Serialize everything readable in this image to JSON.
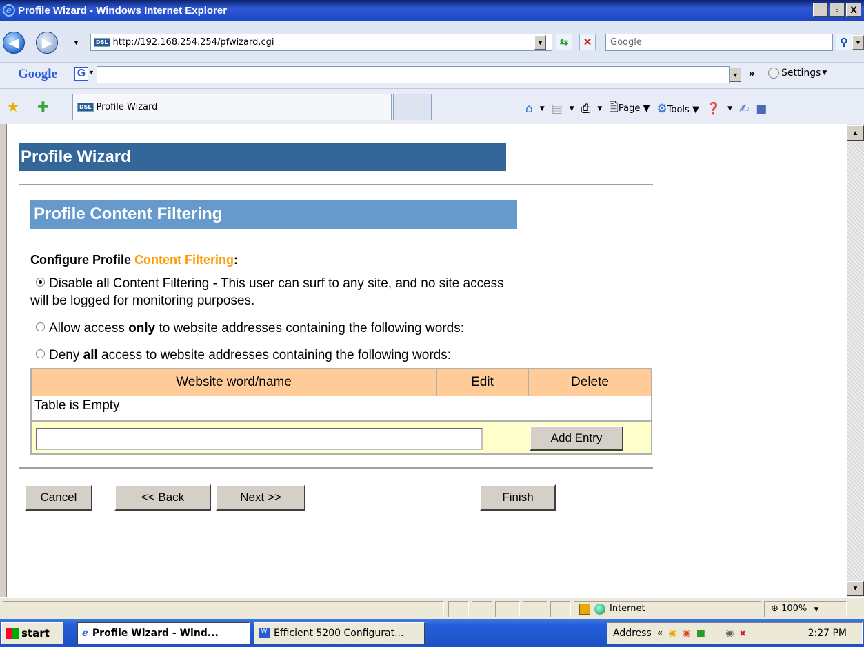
{
  "window": {
    "title": "Profile Wizard - Windows Internet Explorer",
    "min": "_",
    "max": "▫",
    "close": "X"
  },
  "address": {
    "url": "http://192.168.254.254/pfwizard.cgi",
    "favicon": "DSL",
    "search_placeholder": "Google"
  },
  "google_toolbar": {
    "logo_word": "Google",
    "g_btn": "G",
    "settings": "Settings"
  },
  "tabs": {
    "active_tab": "Profile Wizard"
  },
  "command_bar": {
    "page": "Page",
    "tools": "Tools"
  },
  "content": {
    "header": "Profile Wizard",
    "section": "Profile Content Filtering",
    "configure_prefix": "Configure Profile ",
    "configure_highlight": "Content Filtering",
    "configure_suffix": ":",
    "opt1_line1": "Disable all Content Filtering - This user can surf to any site, and no site access",
    "opt1_line2": "will be logged for monitoring purposes.",
    "opt2_pre": "Allow access ",
    "opt2_bold": "only",
    "opt2_post": " to website addresses containing the following words:",
    "opt3_pre": "Deny ",
    "opt3_bold": "all",
    "opt3_post": " access to website addresses containing the following words:"
  },
  "table": {
    "headers": [
      "Website word/name",
      "Edit",
      "Delete"
    ],
    "empty_text": "Table is Empty",
    "new_entry_value": "",
    "add_button": "Add Entry"
  },
  "buttons": {
    "cancel": "Cancel",
    "back": "<< Back",
    "next": "Next >>",
    "finish": "Finish"
  },
  "status_bar": {
    "zone": "Internet",
    "zoom": "100%"
  },
  "taskbar": {
    "start": "start",
    "task1": "Profile Wizard - Wind...",
    "task2": "Efficient 5200 Configurat...",
    "address_label": "Address",
    "clock": "2:27 PM"
  }
}
